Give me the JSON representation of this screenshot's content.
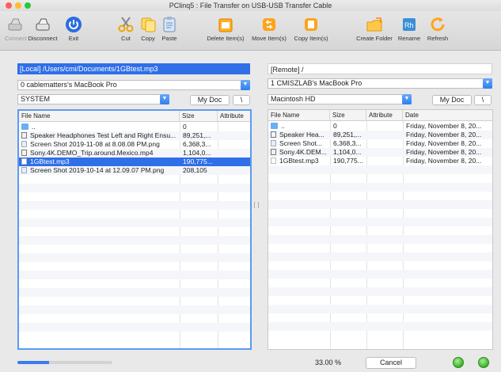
{
  "window_title": "PClinq5 : File Transfer on USB-USB Transfer Cable",
  "toolbar": {
    "connect": "Connect",
    "disconnect": "Disconnect",
    "exit": "Exit",
    "cut": "Cut",
    "copy": "Copy",
    "paste": "Paste",
    "delete": "Delete Item(s)",
    "move": "Move Item(s)",
    "copy_items": "Copy Item(s)",
    "create_folder": "Create Folder",
    "rename": "Rename",
    "refresh": "Refresh"
  },
  "local": {
    "path": "[Local] /Users/cmi/Documents/1GBtest.mp3",
    "computer": "0 cablematters's MacBook Pro",
    "drive": "SYSTEM",
    "my_doc": "My Doc",
    "root_btn": "\\",
    "columns": {
      "name": "File Name",
      "size": "Size",
      "attribute": "Attribute"
    },
    "rows": [
      {
        "name": "..",
        "size": "0",
        "attribute": "",
        "icon": "folder-icon"
      },
      {
        "name": "Speaker Headphones Test Left and Right Ensu...",
        "size": "89,251,...",
        "attribute": "",
        "icon": "video-file-icon"
      },
      {
        "name": "Screen Shot 2019-11-08 at 8.08.08 PM.png",
        "size": "6,368,3...",
        "attribute": "",
        "icon": "image-file-icon"
      },
      {
        "name": "Sony.4K.DEMO_Trip.around.Mexico.mp4",
        "size": "1,104,0...",
        "attribute": "",
        "icon": "video-file-icon"
      },
      {
        "name": "1GBtest.mp3",
        "size": "190,775...",
        "attribute": "",
        "icon": "audio-file-icon"
      },
      {
        "name": "Screen Shot 2019-10-14 at 12.09.07 PM.png",
        "size": "208,105",
        "attribute": "",
        "icon": "image-file-icon"
      }
    ],
    "selected_index": 4
  },
  "remote": {
    "path": "[Remote] /",
    "computer": "1 CMISZLAB's MacBook Pro",
    "drive": "Macintosh HD",
    "my_doc": "My Doc",
    "root_btn": "\\",
    "columns": {
      "name": "File Name",
      "size": "Size",
      "attribute": "Attribute",
      "date": "Date"
    },
    "rows": [
      {
        "name": "..",
        "size": "0",
        "attribute": "",
        "date": "Friday, November 8, 20...",
        "icon": "folder-icon"
      },
      {
        "name": "Speaker Hea...",
        "size": "89,251,...",
        "attribute": "",
        "date": "Friday, November 8, 20...",
        "icon": "video-file-icon"
      },
      {
        "name": "Screen Shot...",
        "size": "6,368,3...",
        "attribute": "",
        "date": "Friday, November 8, 20...",
        "icon": "image-file-icon"
      },
      {
        "name": "Sony.4K.DEM...",
        "size": "1,104,0...",
        "attribute": "",
        "date": "Friday, November 8, 20...",
        "icon": "video-file-icon"
      },
      {
        "name": "1GBtest.mp3",
        "size": "190,775...",
        "attribute": "",
        "date": "Friday, November 8, 20...",
        "icon": "audio-file-icon"
      }
    ]
  },
  "status": {
    "progress_percent": 33,
    "progress_text": "33.00 %",
    "cancel": "Cancel"
  },
  "colors": {
    "accent": "#2f6fe8",
    "local_path_bg": "#2f6fe8",
    "led": "#3eb128"
  }
}
